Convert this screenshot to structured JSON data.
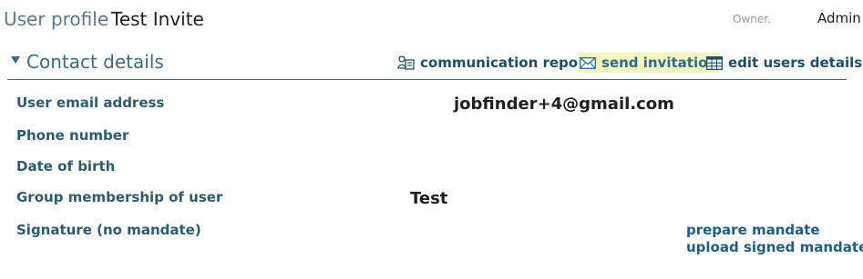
{
  "header": {
    "label": "User profile",
    "name": "Test Invite",
    "owner_label": "Owner.",
    "owner_value": "Admin"
  },
  "section": {
    "title": "Contact details",
    "actions": {
      "communication_report": "communication report",
      "send_invitation": "send invitation",
      "edit_users_details": "edit users details"
    }
  },
  "fields": {
    "email": {
      "label": "User email address",
      "value": "jobfinder+4@gmail.com"
    },
    "phone": {
      "label": "Phone number",
      "value": ""
    },
    "dob": {
      "label": "Date of birth",
      "value": ""
    },
    "group": {
      "label": "Group membership of user",
      "value": "Test"
    },
    "signature": {
      "label": "Signature (no mandate)",
      "links": {
        "prepare": "prepare mandate",
        "upload": "upload signed mandate"
      }
    }
  },
  "icons": {
    "communication_report": "people-report-icon",
    "send_invitation": "envelope-icon",
    "edit_users_details": "table-grid-icon"
  },
  "colors": {
    "accent": "#3a6b7e",
    "link": "#1f5e83",
    "highlight": "#f4f4bf"
  }
}
